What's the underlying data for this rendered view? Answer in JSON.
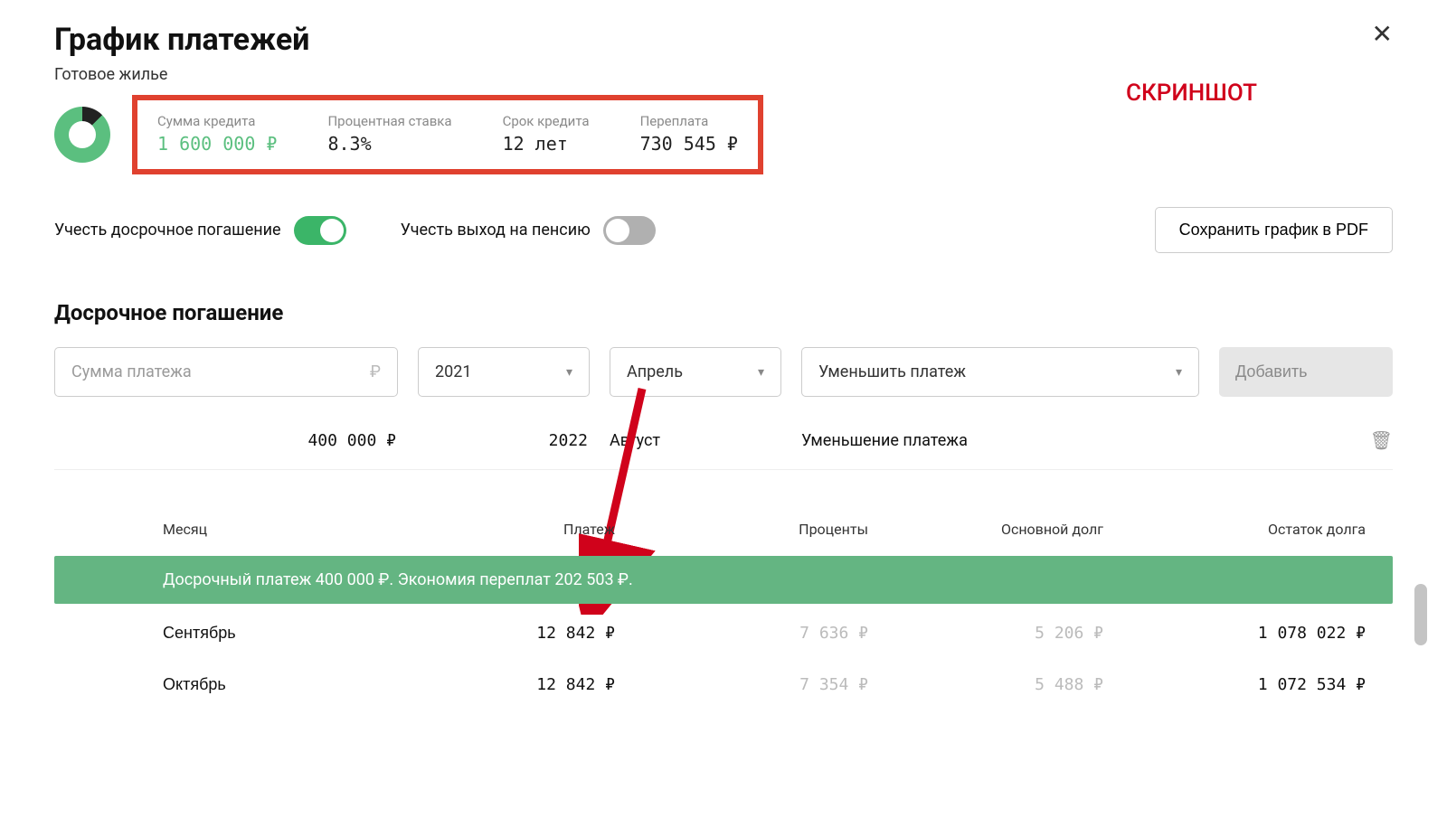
{
  "header": {
    "title": "График платежей",
    "subtitle": "Готовое жилье"
  },
  "annotation": {
    "screenshot": "СКРИНШОТ"
  },
  "summary": {
    "amount": {
      "label": "Сумма кредита",
      "value": "1 600 000 ₽"
    },
    "rate": {
      "label": "Процентная ставка",
      "value": "8.3%"
    },
    "term": {
      "label": "Срок кредита",
      "value": "12 лет"
    },
    "overpay": {
      "label": "Переплата",
      "value": "730 545 ₽"
    }
  },
  "toggles": {
    "early": "Учесть досрочное погашение",
    "pension": "Учесть выход на пенсию"
  },
  "buttons": {
    "save_pdf": "Сохранить график в PDF",
    "add": "Добавить"
  },
  "early_section": {
    "title": "Досрочное погашение"
  },
  "filters": {
    "amount_placeholder": "Сумма платежа",
    "year": "2021",
    "month": "Апрель",
    "action": "Уменьшить платеж"
  },
  "existing": {
    "amount": "400 000 ₽",
    "year": "2022",
    "month": "Август",
    "effect": "Уменьшение платежа"
  },
  "table": {
    "headers": {
      "month": "Месяц",
      "payment": "Платеж",
      "interest": "Проценты",
      "principal": "Основной долг",
      "balance": "Остаток долга"
    },
    "banner": "Досрочный платеж 400 000 ₽. Экономия переплат 202 503 ₽.",
    "rows": [
      {
        "month": "Сентябрь",
        "payment": "12 842 ₽",
        "interest": "7 636 ₽",
        "principal": "5 206 ₽",
        "balance": "1 078 022 ₽"
      },
      {
        "month": "Октябрь",
        "payment": "12 842 ₽",
        "interest": "7 354 ₽",
        "principal": "5 488 ₽",
        "balance": "1 072 534 ₽"
      }
    ]
  }
}
